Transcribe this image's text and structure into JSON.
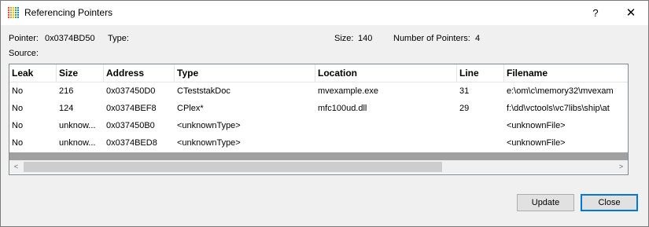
{
  "window": {
    "title": "Referencing Pointers",
    "help_glyph": "?",
    "close_glyph": "✕"
  },
  "info": {
    "pointer_label": "Pointer:",
    "pointer_value": "0x0374BD50",
    "type_label": "Type:",
    "type_value": "",
    "size_label": "Size:",
    "size_value": "140",
    "num_pointers_label": "Number of Pointers:",
    "num_pointers_value": "4",
    "source_label": "Source:",
    "source_value": ""
  },
  "table": {
    "columns": [
      "Leak",
      "Size",
      "Address",
      "Type",
      "Location",
      "Line",
      "Filename"
    ],
    "rows": [
      [
        "No",
        "216",
        "0x037450D0",
        "CTeststakDoc",
        "mvexample.exe",
        "31",
        "e:\\om\\c\\memory32\\mvexam"
      ],
      [
        "No",
        "124",
        "0x0374BEF8",
        "CPlex*",
        "mfc100ud.dll",
        "29",
        "f:\\dd\\vctools\\vc7libs\\ship\\at"
      ],
      [
        "No",
        "unknow...",
        "0x037450B0",
        "<unknownType>",
        "",
        "",
        "<unknownFile>"
      ],
      [
        "No",
        "unknow...",
        "0x0374BED8",
        "<unknownType>",
        "",
        "",
        "<unknownFile>"
      ]
    ],
    "scroll_left": "<",
    "scroll_right": ">"
  },
  "buttons": {
    "update": "Update",
    "close": "Close"
  }
}
